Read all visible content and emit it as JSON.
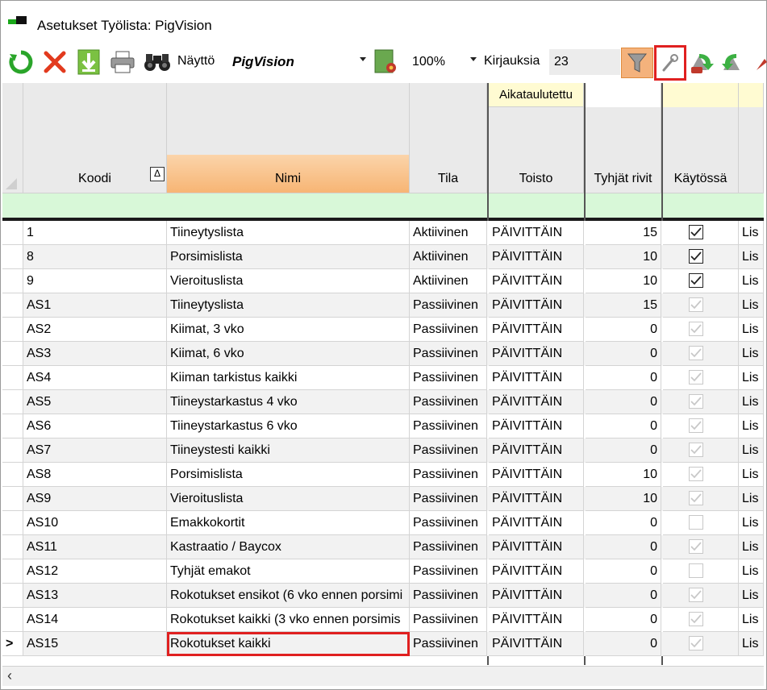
{
  "window": {
    "title": "Asetukset Työlista: PigVision"
  },
  "toolbar": {
    "refresh_icon": "refresh-icon",
    "delete_icon": "delete-x-icon",
    "download_icon": "download-arrow-icon",
    "print_icon": "printer-icon",
    "find_icon": "binoculars-icon",
    "view_label": "Näyttö",
    "view_value": "PigVision",
    "zoom_value": "100%",
    "records_label": "Kirjauksia",
    "records_count": "23",
    "filter_icon": "funnel-icon",
    "settings_icon": "wrench-icon",
    "accent_red": "#e02020"
  },
  "grid": {
    "group_header": "Aikataulutettu",
    "columns": {
      "koodi": "Koodi",
      "nimi": "Nimi",
      "tila": "Tila",
      "toisto": "Toisto",
      "tyhjat": "Tyhjät rivit",
      "kaytossa": "Käytössä"
    },
    "sort_indicator": "Δ",
    "current_row_marker": ">",
    "rows": [
      {
        "koodi": "1",
        "nimi": "Tiineytyslista",
        "tila": "Aktiivinen",
        "toisto": "PÄIVITTÄIN",
        "tyhjat": "15",
        "kaytossa": true,
        "enabled": true,
        "extra": "Lis"
      },
      {
        "koodi": "8",
        "nimi": "Porsimislista",
        "tila": "Aktiivinen",
        "toisto": "PÄIVITTÄIN",
        "tyhjat": "10",
        "kaytossa": true,
        "enabled": true,
        "extra": "Lis"
      },
      {
        "koodi": "9",
        "nimi": "Vieroituslista",
        "tila": "Aktiivinen",
        "toisto": "PÄIVITTÄIN",
        "tyhjat": "10",
        "kaytossa": true,
        "enabled": true,
        "extra": "Lis"
      },
      {
        "koodi": "AS1",
        "nimi": "Tiineytyslista",
        "tila": "Passiivinen",
        "toisto": "PÄIVITTÄIN",
        "tyhjat": "15",
        "kaytossa": true,
        "enabled": false,
        "extra": "Lis"
      },
      {
        "koodi": "AS2",
        "nimi": "Kiimat, 3 vko",
        "tila": "Passiivinen",
        "toisto": "PÄIVITTÄIN",
        "tyhjat": "0",
        "kaytossa": true,
        "enabled": false,
        "extra": "Lis"
      },
      {
        "koodi": "AS3",
        "nimi": "Kiimat, 6 vko",
        "tila": "Passiivinen",
        "toisto": "PÄIVITTÄIN",
        "tyhjat": "0",
        "kaytossa": true,
        "enabled": false,
        "extra": "Lis"
      },
      {
        "koodi": "AS4",
        "nimi": "Kiiman tarkistus kaikki",
        "tila": "Passiivinen",
        "toisto": "PÄIVITTÄIN",
        "tyhjat": "0",
        "kaytossa": true,
        "enabled": false,
        "extra": "Lis"
      },
      {
        "koodi": "AS5",
        "nimi": "Tiineystarkastus 4 vko",
        "tila": "Passiivinen",
        "toisto": "PÄIVITTÄIN",
        "tyhjat": "0",
        "kaytossa": true,
        "enabled": false,
        "extra": "Lis"
      },
      {
        "koodi": "AS6",
        "nimi": "Tiineystarkastus 6 vko",
        "tila": "Passiivinen",
        "toisto": "PÄIVITTÄIN",
        "tyhjat": "0",
        "kaytossa": true,
        "enabled": false,
        "extra": "Lis"
      },
      {
        "koodi": "AS7",
        "nimi": "Tiineystesti kaikki",
        "tila": "Passiivinen",
        "toisto": "PÄIVITTÄIN",
        "tyhjat": "0",
        "kaytossa": true,
        "enabled": false,
        "extra": "Lis"
      },
      {
        "koodi": "AS8",
        "nimi": "Porsimislista",
        "tila": "Passiivinen",
        "toisto": "PÄIVITTÄIN",
        "tyhjat": "10",
        "kaytossa": true,
        "enabled": false,
        "extra": "Lis"
      },
      {
        "koodi": "AS9",
        "nimi": "Vieroituslista",
        "tila": "Passiivinen",
        "toisto": "PÄIVITTÄIN",
        "tyhjat": "10",
        "kaytossa": true,
        "enabled": false,
        "extra": "Lis"
      },
      {
        "koodi": "AS10",
        "nimi": "Emakkokortit",
        "tila": "Passiivinen",
        "toisto": "PÄIVITTÄIN",
        "tyhjat": "0",
        "kaytossa": false,
        "enabled": false,
        "extra": "Lis"
      },
      {
        "koodi": "AS11",
        "nimi": "Kastraatio / Baycox",
        "tila": "Passiivinen",
        "toisto": "PÄIVITTÄIN",
        "tyhjat": "0",
        "kaytossa": true,
        "enabled": false,
        "extra": "Lis"
      },
      {
        "koodi": "AS12",
        "nimi": "Tyhjät emakot",
        "tila": "Passiivinen",
        "toisto": "PÄIVITTÄIN",
        "tyhjat": "0",
        "kaytossa": false,
        "enabled": false,
        "extra": "Lis"
      },
      {
        "koodi": "AS13",
        "nimi": "Rokotukset ensikot (6 vko ennen porsimi",
        "tila": "Passiivinen",
        "toisto": "PÄIVITTÄIN",
        "tyhjat": "0",
        "kaytossa": true,
        "enabled": false,
        "extra": "Lis"
      },
      {
        "koodi": "AS14",
        "nimi": "Rokotukset kaikki (3 vko ennen porsimis",
        "tila": "Passiivinen",
        "toisto": "PÄIVITTÄIN",
        "tyhjat": "0",
        "kaytossa": true,
        "enabled": false,
        "extra": "Lis"
      },
      {
        "koodi": "AS15",
        "nimi": "Rokotukset kaikki",
        "tila": "Passiivinen",
        "toisto": "PÄIVITTÄIN",
        "tyhjat": "0",
        "kaytossa": true,
        "enabled": false,
        "extra": "Lis",
        "current": true,
        "highlight": true
      }
    ],
    "colors": {
      "header_bg": "#eaeaea",
      "sorted_header": "#f7b574",
      "group_bg": "#fffbd2",
      "filter_row": "#d8f8d8",
      "row_even": "#ffffff",
      "row_odd": "#f2f2f2"
    }
  },
  "scrollbar": {
    "left_arrow": "‹"
  }
}
